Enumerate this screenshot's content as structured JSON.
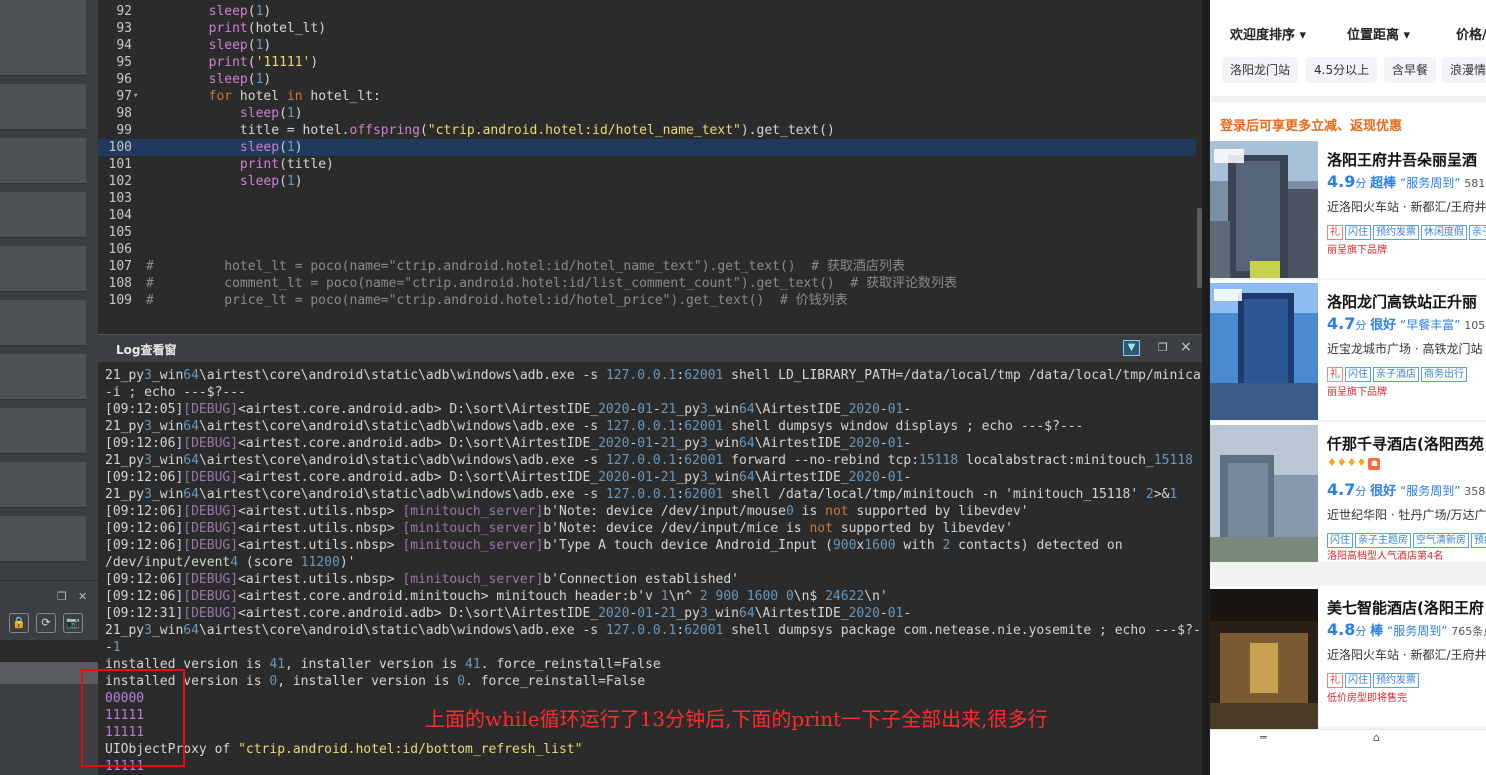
{
  "editor": {
    "lines": [
      {
        "n": "92",
        "fold": "",
        "hl": false,
        "indent": "        ",
        "parts": [
          [
            "fn",
            "sleep"
          ],
          [
            "",
            "("
          ],
          [
            "nu",
            "1"
          ],
          [
            "",
            ")"
          ]
        ]
      },
      {
        "n": "93",
        "fold": "",
        "hl": false,
        "indent": "        ",
        "parts": [
          [
            "fn",
            "print"
          ],
          [
            "",
            "(hotel_lt)"
          ]
        ]
      },
      {
        "n": "94",
        "fold": "",
        "hl": false,
        "indent": "        ",
        "parts": [
          [
            "fn",
            "sleep"
          ],
          [
            "",
            "("
          ],
          [
            "nu",
            "1"
          ],
          [
            "",
            ")"
          ]
        ]
      },
      {
        "n": "95",
        "fold": "",
        "hl": false,
        "indent": "        ",
        "parts": [
          [
            "fn",
            "print"
          ],
          [
            "",
            "("
          ],
          [
            "st",
            "'11111'"
          ],
          [
            "",
            ")"
          ]
        ]
      },
      {
        "n": "96",
        "fold": "",
        "hl": false,
        "indent": "        ",
        "parts": [
          [
            "fn",
            "sleep"
          ],
          [
            "",
            "("
          ],
          [
            "nu",
            "1"
          ],
          [
            "",
            ")"
          ]
        ]
      },
      {
        "n": "97",
        "fold": "▾",
        "hl": false,
        "indent": "        ",
        "parts": [
          [
            "kw",
            "for"
          ],
          [
            "",
            " hotel "
          ],
          [
            "kw",
            "in"
          ],
          [
            "",
            " hotel_lt:"
          ]
        ]
      },
      {
        "n": "98",
        "fold": "",
        "hl": false,
        "indent": "            ",
        "parts": [
          [
            "fn",
            "sleep"
          ],
          [
            "",
            "("
          ],
          [
            "nu",
            "1"
          ],
          [
            "",
            ")"
          ]
        ]
      },
      {
        "n": "99",
        "fold": "",
        "hl": false,
        "indent": "            ",
        "parts": [
          [
            "",
            "title = hotel."
          ],
          [
            "fn",
            "offspring"
          ],
          [
            "",
            "("
          ],
          [
            "st",
            "\"ctrip.android.hotel:id/hotel_name_text\""
          ],
          [
            "",
            ").get_text()"
          ]
        ]
      },
      {
        "n": "100",
        "fold": "",
        "hl": true,
        "indent": "            ",
        "parts": [
          [
            "fn",
            "sleep"
          ],
          [
            "",
            "("
          ],
          [
            "nu",
            "1"
          ],
          [
            "",
            ")"
          ]
        ]
      },
      {
        "n": "101",
        "fold": "",
        "hl": false,
        "indent": "            ",
        "parts": [
          [
            "fn",
            "print"
          ],
          [
            "",
            "(title)"
          ]
        ]
      },
      {
        "n": "102",
        "fold": "",
        "hl": false,
        "indent": "            ",
        "parts": [
          [
            "fn",
            "sleep"
          ],
          [
            "",
            "("
          ],
          [
            "nu",
            "1"
          ],
          [
            "",
            ")"
          ]
        ]
      },
      {
        "n": "103",
        "fold": "",
        "hl": false,
        "indent": "",
        "parts": []
      },
      {
        "n": "104",
        "fold": "",
        "hl": false,
        "indent": "",
        "parts": []
      },
      {
        "n": "105",
        "fold": "",
        "hl": false,
        "indent": "",
        "parts": []
      },
      {
        "n": "106",
        "fold": "",
        "hl": false,
        "indent": "",
        "parts": []
      },
      {
        "n": "107",
        "fold": "",
        "hl": false,
        "indent": "",
        "parts": [
          [
            "cm",
            "#         hotel_lt = poco(name=\"ctrip.android.hotel:id/hotel_name_text\").get_text()  # 获取酒店列表"
          ]
        ]
      },
      {
        "n": "108",
        "fold": "",
        "hl": false,
        "indent": "",
        "parts": [
          [
            "cm",
            "#         comment_lt = poco(name=\"ctrip.android.hotel:id/list_comment_count\").get_text()  # 获取评论数列表"
          ]
        ]
      },
      {
        "n": "109",
        "fold": "",
        "hl": false,
        "indent": "",
        "parts": [
          [
            "cm",
            "#         price_lt = poco(name=\"ctrip.android.hotel:id/hotel_price\").get_text()  # 价钱列表"
          ]
        ]
      }
    ]
  },
  "log": {
    "title": "Log查看窗",
    "lines": [
      [
        [
          "",
          "21_py"
        ],
        [
          "lnum",
          "3"
        ],
        [
          "",
          "_win"
        ],
        [
          "lnum",
          "64"
        ],
        [
          "",
          "\\airtest\\core\\android\\static\\adb\\windows\\adb.exe -s "
        ],
        [
          "lnum",
          "127.0.0.1"
        ],
        [
          "",
          ":"
        ],
        [
          "lnum",
          "62001"
        ],
        [
          "",
          " shell LD_LIBRARY_PATH=/data/local/tmp /data/local/tmp/minicap"
        ]
      ],
      [
        [
          "",
          "-i ; echo ---$?---"
        ]
      ],
      [
        [
          "",
          "[09:12:05]"
        ],
        [
          "dbg",
          "[DEBUG]"
        ],
        [
          "",
          "<airtest.core.android.adb> D:\\sort\\AirtestIDE_"
        ],
        [
          "lnum",
          "2020"
        ],
        [
          "",
          "-"
        ],
        [
          "lnum",
          "01"
        ],
        [
          "",
          "-"
        ],
        [
          "lnum",
          "21"
        ],
        [
          "",
          "_py"
        ],
        [
          "lnum",
          "3"
        ],
        [
          "",
          "_win"
        ],
        [
          "lnum",
          "64"
        ],
        [
          "",
          "\\AirtestIDE_"
        ],
        [
          "lnum",
          "2020"
        ],
        [
          "",
          "-"
        ],
        [
          "lnum",
          "01"
        ],
        [
          "",
          "-"
        ]
      ],
      [
        [
          "",
          "21_py"
        ],
        [
          "lnum",
          "3"
        ],
        [
          "",
          "_win"
        ],
        [
          "lnum",
          "64"
        ],
        [
          "",
          "\\airtest\\core\\android\\static\\adb\\windows\\adb.exe -s "
        ],
        [
          "lnum",
          "127.0.0.1"
        ],
        [
          "",
          ":"
        ],
        [
          "lnum",
          "62001"
        ],
        [
          "",
          " shell dumpsys window displays ; echo ---$?---"
        ]
      ],
      [
        [
          "",
          "[09:12:06]"
        ],
        [
          "dbg",
          "[DEBUG]"
        ],
        [
          "",
          "<airtest.core.android.adb> D:\\sort\\AirtestIDE_"
        ],
        [
          "lnum",
          "2020"
        ],
        [
          "",
          "-"
        ],
        [
          "lnum",
          "01"
        ],
        [
          "",
          "-"
        ],
        [
          "lnum",
          "21"
        ],
        [
          "",
          "_py"
        ],
        [
          "lnum",
          "3"
        ],
        [
          "",
          "_win"
        ],
        [
          "lnum",
          "64"
        ],
        [
          "",
          "\\AirtestIDE_"
        ],
        [
          "lnum",
          "2020"
        ],
        [
          "",
          "-"
        ],
        [
          "lnum",
          "01"
        ],
        [
          "",
          "-"
        ]
      ],
      [
        [
          "",
          "21_py"
        ],
        [
          "lnum",
          "3"
        ],
        [
          "",
          "_win"
        ],
        [
          "lnum",
          "64"
        ],
        [
          "",
          "\\airtest\\core\\android\\static\\adb\\windows\\adb.exe -s "
        ],
        [
          "lnum",
          "127.0.0.1"
        ],
        [
          "",
          ":"
        ],
        [
          "lnum",
          "62001"
        ],
        [
          "",
          " forward --no-rebind tcp:"
        ],
        [
          "lnum",
          "15118"
        ],
        [
          "",
          " localabstract:minitouch_"
        ],
        [
          "lnum",
          "15118"
        ]
      ],
      [
        [
          "",
          "[09:12:06]"
        ],
        [
          "dbg",
          "[DEBUG]"
        ],
        [
          "",
          "<airtest.core.android.adb> D:\\sort\\AirtestIDE_"
        ],
        [
          "lnum",
          "2020"
        ],
        [
          "",
          "-"
        ],
        [
          "lnum",
          "01"
        ],
        [
          "",
          "-"
        ],
        [
          "lnum",
          "21"
        ],
        [
          "",
          "_py"
        ],
        [
          "lnum",
          "3"
        ],
        [
          "",
          "_win"
        ],
        [
          "lnum",
          "64"
        ],
        [
          "",
          "\\AirtestIDE_"
        ],
        [
          "lnum",
          "2020"
        ],
        [
          "",
          "-"
        ],
        [
          "lnum",
          "01"
        ],
        [
          "",
          "-"
        ]
      ],
      [
        [
          "",
          "21_py"
        ],
        [
          "lnum",
          "3"
        ],
        [
          "",
          "_win"
        ],
        [
          "lnum",
          "64"
        ],
        [
          "",
          "\\airtest\\core\\android\\static\\adb\\windows\\adb.exe -s "
        ],
        [
          "lnum",
          "127.0.0.1"
        ],
        [
          "",
          ":"
        ],
        [
          "lnum",
          "62001"
        ],
        [
          "",
          " shell /data/local/tmp/minitouch -n 'minitouch_15118' "
        ],
        [
          "lnum",
          "2"
        ],
        [
          "",
          ">&"
        ],
        [
          "lnum",
          "1"
        ]
      ],
      [
        [
          "",
          "[09:12:06]"
        ],
        [
          "dbg",
          "[DEBUG]"
        ],
        [
          "",
          "<airtest.utils.nbsp> "
        ],
        [
          "srv",
          "[minitouch_server]"
        ],
        [
          "",
          "b'Note: device /dev/input/mouse"
        ],
        [
          "lnum",
          "0"
        ],
        [
          "",
          " is "
        ],
        [
          "lkw",
          "not"
        ],
        [
          "",
          " supported by libevdev'"
        ]
      ],
      [
        [
          "",
          "[09:12:06]"
        ],
        [
          "dbg",
          "[DEBUG]"
        ],
        [
          "",
          "<airtest.utils.nbsp> "
        ],
        [
          "srv",
          "[minitouch_server]"
        ],
        [
          "",
          "b'Note: device /dev/input/mice is "
        ],
        [
          "lkw",
          "not"
        ],
        [
          "",
          " supported by libevdev'"
        ]
      ],
      [
        [
          "",
          "[09:12:06]"
        ],
        [
          "dbg",
          "[DEBUG]"
        ],
        [
          "",
          "<airtest.utils.nbsp> "
        ],
        [
          "srv",
          "[minitouch_server]"
        ],
        [
          "",
          "b'Type A touch device Android_Input ("
        ],
        [
          "lnum",
          "900"
        ],
        [
          "",
          "x"
        ],
        [
          "lnum",
          "1600"
        ],
        [
          "",
          " with "
        ],
        [
          "lnum",
          "2"
        ],
        [
          "",
          " contacts) detected on"
        ]
      ],
      [
        [
          "",
          "/dev/input/event"
        ],
        [
          "lnum",
          "4"
        ],
        [
          "",
          " (score "
        ],
        [
          "lnum",
          "11200"
        ],
        [
          "",
          ")'"
        ]
      ],
      [
        [
          "",
          "[09:12:06]"
        ],
        [
          "dbg",
          "[DEBUG]"
        ],
        [
          "",
          "<airtest.utils.nbsp> "
        ],
        [
          "srv",
          "[minitouch_server]"
        ],
        [
          "",
          "b'Connection established'"
        ]
      ],
      [
        [
          "",
          "[09:12:06]"
        ],
        [
          "dbg",
          "[DEBUG]"
        ],
        [
          "",
          "<airtest.core.android.minitouch> minitouch header:b'v "
        ],
        [
          "lnum",
          "1"
        ],
        [
          "",
          "\\n^ "
        ],
        [
          "lnum",
          "2"
        ],
        [
          "",
          " "
        ],
        [
          "lnum",
          "900"
        ],
        [
          "",
          " "
        ],
        [
          "lnum",
          "1600"
        ],
        [
          "",
          " "
        ],
        [
          "lnum",
          "0"
        ],
        [
          "",
          "\\n$ "
        ],
        [
          "lnum",
          "24622"
        ],
        [
          "",
          "\\n'"
        ]
      ],
      [
        [
          "",
          "[09:12:31]"
        ],
        [
          "dbg",
          "[DEBUG]"
        ],
        [
          "",
          "<airtest.core.android.adb> D:\\sort\\AirtestIDE_"
        ],
        [
          "lnum",
          "2020"
        ],
        [
          "",
          "-"
        ],
        [
          "lnum",
          "01"
        ],
        [
          "",
          "-"
        ],
        [
          "lnum",
          "21"
        ],
        [
          "",
          "_py"
        ],
        [
          "lnum",
          "3"
        ],
        [
          "",
          "_win"
        ],
        [
          "lnum",
          "64"
        ],
        [
          "",
          "\\AirtestIDE_"
        ],
        [
          "lnum",
          "2020"
        ],
        [
          "",
          "-"
        ],
        [
          "lnum",
          "01"
        ],
        [
          "",
          "-"
        ]
      ],
      [
        [
          "",
          "21_py"
        ],
        [
          "lnum",
          "3"
        ],
        [
          "",
          "_win"
        ],
        [
          "lnum",
          "64"
        ],
        [
          "",
          "\\airtest\\core\\android\\static\\adb\\windows\\adb.exe -s "
        ],
        [
          "lnum",
          "127.0.0.1"
        ],
        [
          "",
          ":"
        ],
        [
          "lnum",
          "62001"
        ],
        [
          "",
          " shell dumpsys package com.netease.nie.yosemite ; echo ---$?--"
        ]
      ],
      [
        [
          "",
          "-"
        ],
        [
          "lnum",
          "1"
        ]
      ],
      [
        [
          "",
          "installed version is "
        ],
        [
          "lnum",
          "41"
        ],
        [
          "",
          ", installer version is "
        ],
        [
          "lnum",
          "41"
        ],
        [
          "",
          ". force_reinstall=False"
        ]
      ],
      [
        [
          "",
          "installed version is "
        ],
        [
          "lnum",
          "0"
        ],
        [
          "",
          ", installer version is "
        ],
        [
          "lnum",
          "0"
        ],
        [
          "",
          ". force_reinstall=False"
        ]
      ],
      [
        [
          "purple",
          "00000"
        ]
      ],
      [
        [
          "purple",
          "11111"
        ]
      ],
      [
        [
          "purple",
          "11111"
        ]
      ],
      [
        [
          "",
          "UIObjectProxy of "
        ],
        [
          "lstr",
          "\"ctrip.android.hotel:id/bottom_refresh_list\""
        ]
      ],
      [
        [
          "purple",
          "11111"
        ]
      ]
    ],
    "annotation": "上面的while循环运行了13分钟后,下面的print一下子全部出来,很多行"
  },
  "left_panel": {
    "tools": [
      "🔒",
      "⟳",
      "📷"
    ],
    "win_restore": "❐",
    "win_close": "✕"
  },
  "phone": {
    "sort_options": [
      "欢迎度排序 ▾",
      "位置距离 ▾",
      "价格/"
    ],
    "filter_chips": [
      "洛阳龙门站",
      "4.5分以上",
      "含早餐",
      "浪漫情"
    ],
    "promo": "登录后可享更多立减、返现优惠",
    "hotels": [
      {
        "name": "洛阳王府井吾朵丽呈酒",
        "stars": "",
        "score": "4.9",
        "unit": "分",
        "level": "超棒",
        "quote": "“服务周到”",
        "reviews": "5814",
        "location": "近洛阳火车站 · 新都汇/王府井",
        "tags": [
          "礼",
          "闪住",
          "预约发票",
          "休闲度假",
          "亲子"
        ],
        "brand": "丽呈旗下品牌",
        "img_label": "RE'ZEN HOTEL"
      },
      {
        "name": "洛阳龙门高铁站正升丽",
        "stars": "",
        "score": "4.7",
        "unit": "分",
        "level": "很好",
        "quote": "“早餐丰富”",
        "reviews": "1053",
        "location": "近宝龙城市广场 · 高铁龙门站",
        "tags": [
          "礼",
          "闪住",
          "亲子酒店",
          "商务出行"
        ],
        "brand": "丽呈旗下品牌",
        "img_label": "RE'ZEN HOTEL"
      },
      {
        "name": "仟那千寻酒店(洛阳西苑",
        "stars": "♦♦♦♦",
        "score": "4.7",
        "unit": "分",
        "level": "很好",
        "quote": "“服务周到”",
        "reviews": "3581",
        "location": "近世纪华阳 · 牡丹广场/万达广",
        "tags": [
          "闪住",
          "亲子主题房",
          "空气清新房",
          "预约"
        ],
        "brand": "洛阳高档型人气酒店第4名",
        "img_label": ""
      },
      {
        "name": "美七智能酒店(洛阳王府",
        "stars": "",
        "score": "4.8",
        "unit": "分",
        "level": "棒",
        "quote": "“服务周到”",
        "reviews": "765条点",
        "location": "近洛阳火车站 · 新都汇/王府井",
        "tags": [
          "礼",
          "闪住",
          "预约发票"
        ],
        "brand": "低价房型即将售完",
        "img_label": "美七商务酒店"
      }
    ],
    "nav": [
      "═",
      "⌂"
    ]
  }
}
